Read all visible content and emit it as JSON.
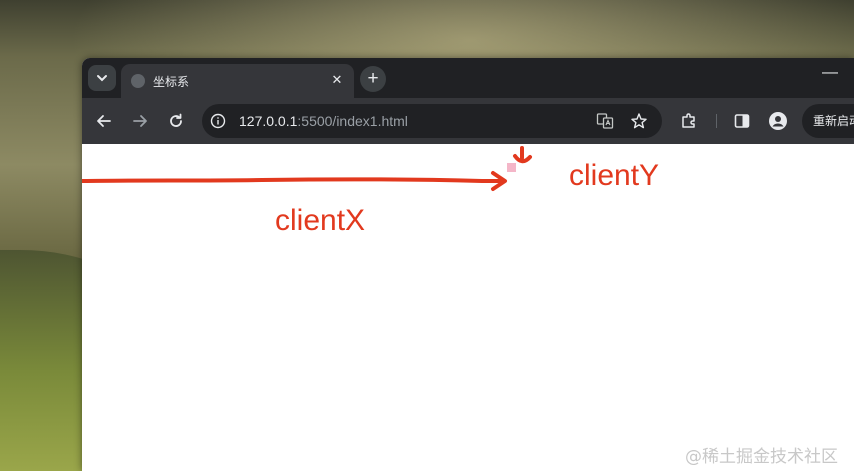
{
  "browser": {
    "tab": {
      "title": "坐标系"
    },
    "address": {
      "host": "127.0.0.1",
      "rest": ":5500/index1.html"
    },
    "restart_label": "重新启动"
  },
  "annotations": {
    "x_label": "clientX",
    "y_label": "clientY",
    "color": "#e2391e"
  },
  "watermark": "@稀土掘金技术社区"
}
